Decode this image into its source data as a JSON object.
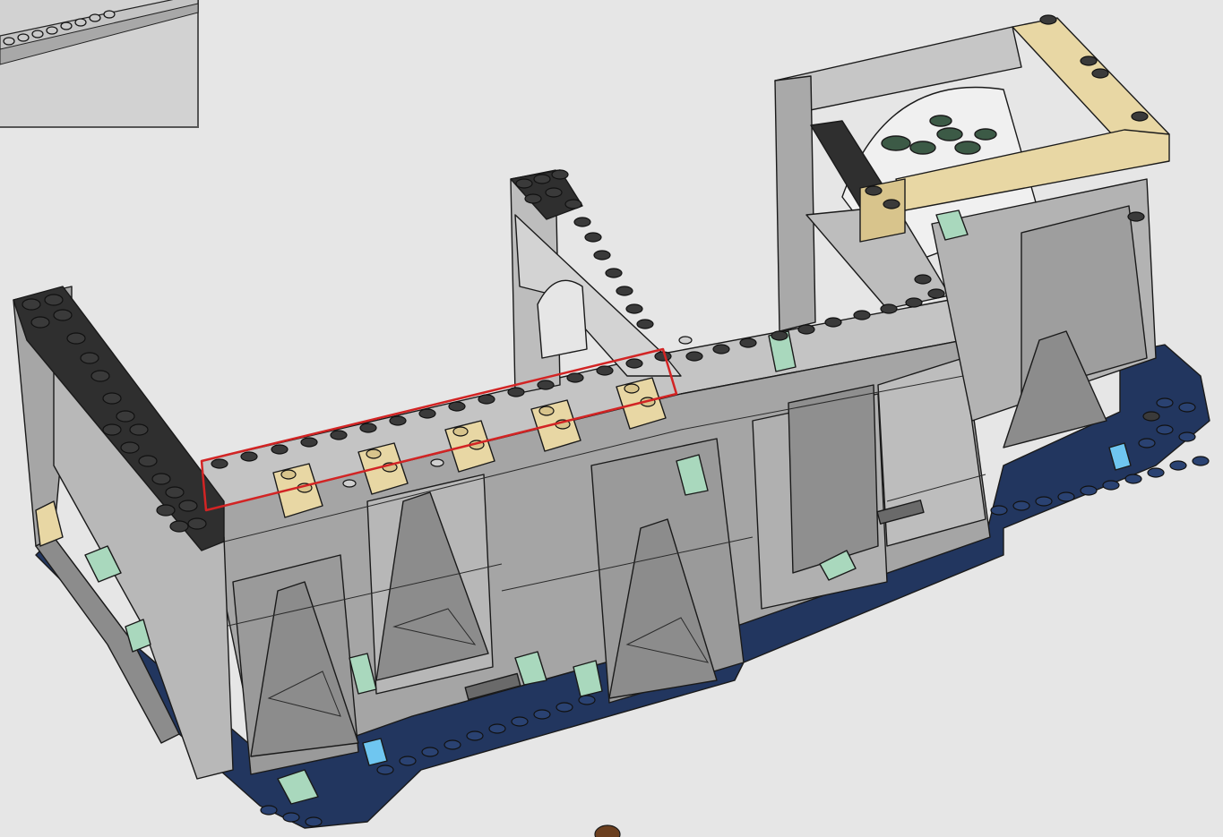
{
  "page": {
    "kind": "building-instruction-step",
    "background": "#e6e6e6"
  },
  "callout": {
    "border_color": "#555555",
    "fill": "#d2d2d2"
  },
  "highlight": {
    "color": "#d22424"
  },
  "colors": {
    "light_bluish_gray": "#bdbdbd",
    "dark_bluish_gray": "#8a8a8a",
    "black": "#2b2b2b",
    "dark_blue": "#22365f",
    "tan": "#e8d7a4",
    "sand_green": "#a9d8bd",
    "trans_light_blue": "#6fc6f0",
    "dark_green": "#3c5a46"
  }
}
